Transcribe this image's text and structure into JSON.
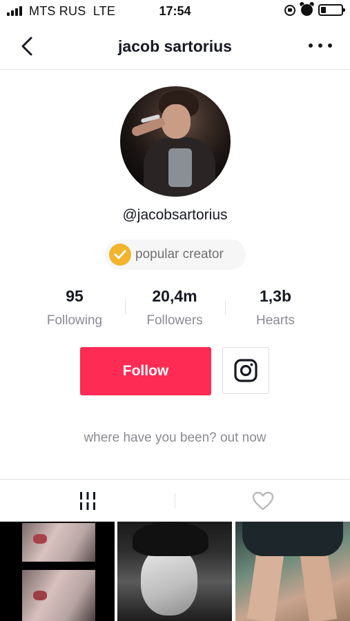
{
  "status_bar": {
    "carrier": "MTS RUS",
    "network": "LTE",
    "time": "17:54",
    "icons": [
      "signal-icon",
      "rotation-lock-icon",
      "alarm-icon",
      "battery-icon"
    ]
  },
  "nav": {
    "title": "jacob sartorius",
    "back_icon": "chevron-left-icon",
    "more_icon": "more-dots-icon"
  },
  "profile": {
    "handle": "@jacobsartorius",
    "badge_label": "popular creator",
    "badge_color": "#f2b42c",
    "stats": [
      {
        "value": "95",
        "label": "Following"
      },
      {
        "value": "20,4m",
        "label": "Followers"
      },
      {
        "value": "1,3b",
        "label": "Hearts"
      }
    ],
    "follow_label": "Follow",
    "follow_color": "#fe2c55",
    "bio": "where have you been? out now"
  },
  "tabs": {
    "items": [
      {
        "icon": "videos-grid-icon",
        "active": true
      },
      {
        "icon": "heart-icon",
        "active": false
      }
    ]
  },
  "videos": [
    {
      "name": "video-thumb-1"
    },
    {
      "name": "video-thumb-2"
    },
    {
      "name": "video-thumb-3"
    }
  ]
}
